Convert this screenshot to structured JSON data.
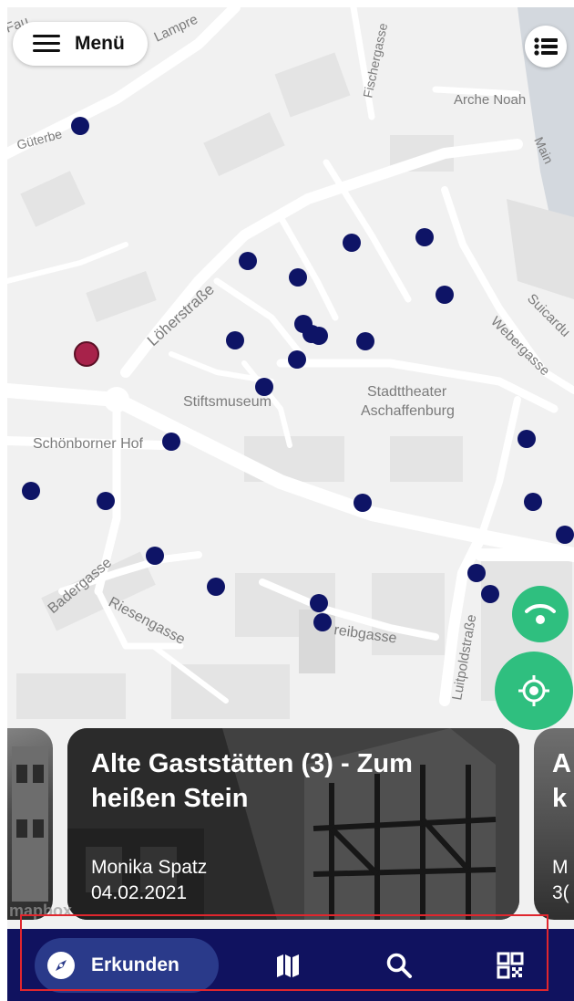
{
  "colors": {
    "map_background": "#f1f1f1",
    "road": "#ffffff",
    "marker_default": "#0e1466",
    "marker_selected": "#a7224a",
    "fab_green": "#2fbf7f",
    "nav_background": "#10125f",
    "nav_active_pill": "#2a3a8a",
    "highlight_border": "#e0262e"
  },
  "header": {
    "menu_label": "Menü",
    "menu_icon": "hamburger-icon",
    "list_icon": "list-icon"
  },
  "map": {
    "street_labels": {
      "fau": "Fau",
      "lampre": "Lampre",
      "fischergasse": "Fischergasse",
      "arche_noah": "Arche Noah",
      "main": "Main",
      "gueterbe": "Güterbe",
      "loherstrasse": "Löherstraße",
      "suicardu": "Suicardu",
      "webergasse": "Webergasse",
      "stiftsmuseum": "Stiftsmuseum",
      "stadttheater_1": "Stadttheater",
      "stadttheater_2": "Aschaffenburg",
      "schoenborner_hof": "Schönborner Hof",
      "badergasse": "Badergasse",
      "riesengasse": "Riesengasse",
      "treibgasse": "reibgasse",
      "luitpoldstrasse": "Luitpoldstraße"
    },
    "marker_count": 30,
    "selected_marker_count": 1,
    "attribution": "mapbox"
  },
  "fabs": {
    "wifi_icon": "wifi-signal-icon",
    "locate_icon": "my-location-icon"
  },
  "cards": [
    {
      "title": "",
      "author": "",
      "date": ""
    },
    {
      "title": "Alte Gaststätten (3) - Zum heißen Stein",
      "author": "Monika Spatz",
      "date": "04.02.2021"
    },
    {
      "title": "A\nk",
      "author": "M",
      "date": "3("
    }
  ],
  "bottom_nav": {
    "items": [
      {
        "label": "Erkunden",
        "icon": "compass-icon",
        "active": true
      },
      {
        "label": "",
        "icon": "map-icon",
        "active": false
      },
      {
        "label": "",
        "icon": "search-icon",
        "active": false
      },
      {
        "label": "",
        "icon": "qr-code-icon",
        "active": false
      }
    ]
  }
}
